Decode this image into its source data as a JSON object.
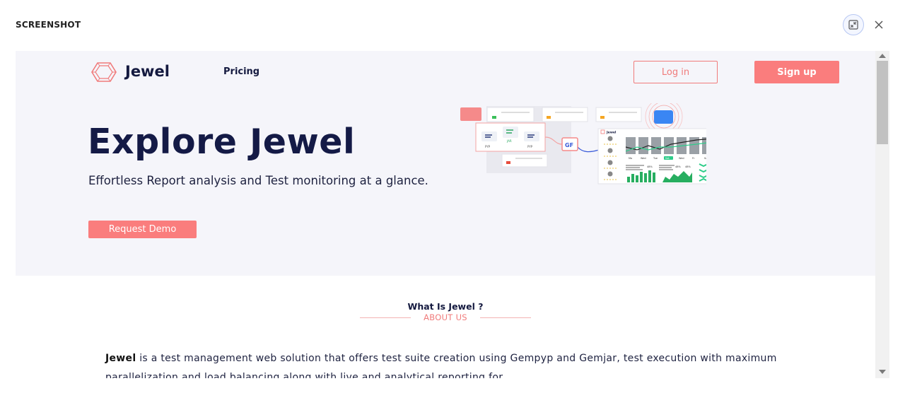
{
  "modal": {
    "title": "SCREENSHOT"
  },
  "nav": {
    "brand": "Jewel",
    "pricing": "Pricing",
    "login": "Log in",
    "signup": "Sign up"
  },
  "hero": {
    "title": "Explore Jewel",
    "subtitle": "Effortless Report analysis and Test monitoring at a glance.",
    "demo_button": "Request Demo"
  },
  "illustration": {
    "dashboard_brand": "Jewel",
    "days": [
      "Mo",
      "Wed",
      "Tue",
      "Sat",
      "Wed",
      "Fr",
      "Sa"
    ],
    "percents": [
      "48%",
      "48%",
      "48%"
    ],
    "node_labels": [
      "PYP",
      "JAR",
      "PYP"
    ]
  },
  "about": {
    "heading": "What Is Jewel ?",
    "subheading": "ABOUT US",
    "desc_bold": "Jewel",
    "desc_text": " is a test management web solution that offers test suite creation using Gempyp and Gemjar, test execution with maximum parallelization and load balancing along with live and analytical reporting for"
  },
  "colors": {
    "accent": "#fa7d7d",
    "navy": "#141a46",
    "hero_bg": "#f5f5fa"
  },
  "icons": {
    "logo": "jewel-logo-icon",
    "collapse": "collapse-icon",
    "close": "close-icon"
  }
}
